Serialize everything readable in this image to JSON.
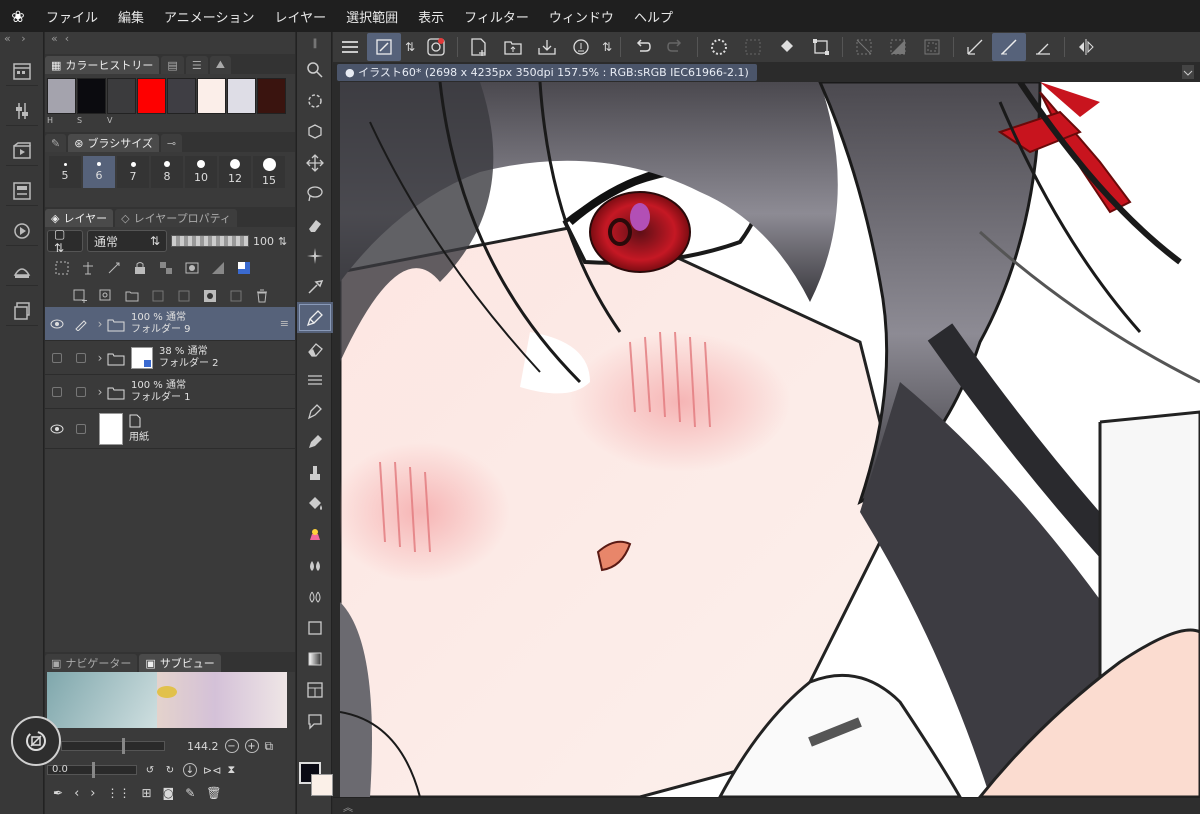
{
  "menubar": {
    "logo": "❀",
    "items": [
      "ファイル",
      "編集",
      "アニメーション",
      "レイヤー",
      "選択範囲",
      "表示",
      "フィルター",
      "ウィンドウ",
      "ヘルプ"
    ]
  },
  "color_history": {
    "tab_label": "カラーヒストリー",
    "swatches": [
      "#a4a3ad",
      "#0b0b0f",
      "#3b3b3d",
      "#fe0000",
      "#3f3e44",
      "#fbeee9",
      "#dedde6",
      "#3a140f"
    ],
    "hsv_labels": [
      "H",
      "S",
      "V"
    ]
  },
  "brush_size": {
    "tab_label": "ブラシサイズ",
    "sizes": [
      "5",
      "6",
      "7",
      "8",
      "10",
      "12",
      "15"
    ],
    "selected": "6"
  },
  "layer_panel": {
    "tab_layer": "レイヤー",
    "tab_properties": "レイヤープロパティ",
    "blend_mode": "通常",
    "opacity": "100",
    "layers": [
      {
        "opacity": "100 %",
        "mode": "通常",
        "name": "フォルダー 9",
        "visible": true,
        "selected": true
      },
      {
        "opacity": "38 %",
        "mode": "通常",
        "name": "フォルダー 2",
        "visible": false,
        "selected": false
      },
      {
        "opacity": "100 %",
        "mode": "通常",
        "name": "フォルダー 1",
        "visible": false,
        "selected": false
      },
      {
        "opacity": "",
        "mode": "",
        "name": "用紙",
        "visible": true,
        "selected": false
      }
    ]
  },
  "subview": {
    "tab_navigator": "ナビゲーター",
    "tab_subview": "サブビュー",
    "zoom": "144.2",
    "rotation": "0.0"
  },
  "canvas": {
    "tab_title": "イラスト60* (2698 x 4235px 350dpi 157.5% : RGB:sRGB IEC61966-2.1)"
  },
  "colors": {
    "main": "#0a0a14",
    "sub": "#fbf0e8",
    "accent_selected": "#56627a"
  }
}
